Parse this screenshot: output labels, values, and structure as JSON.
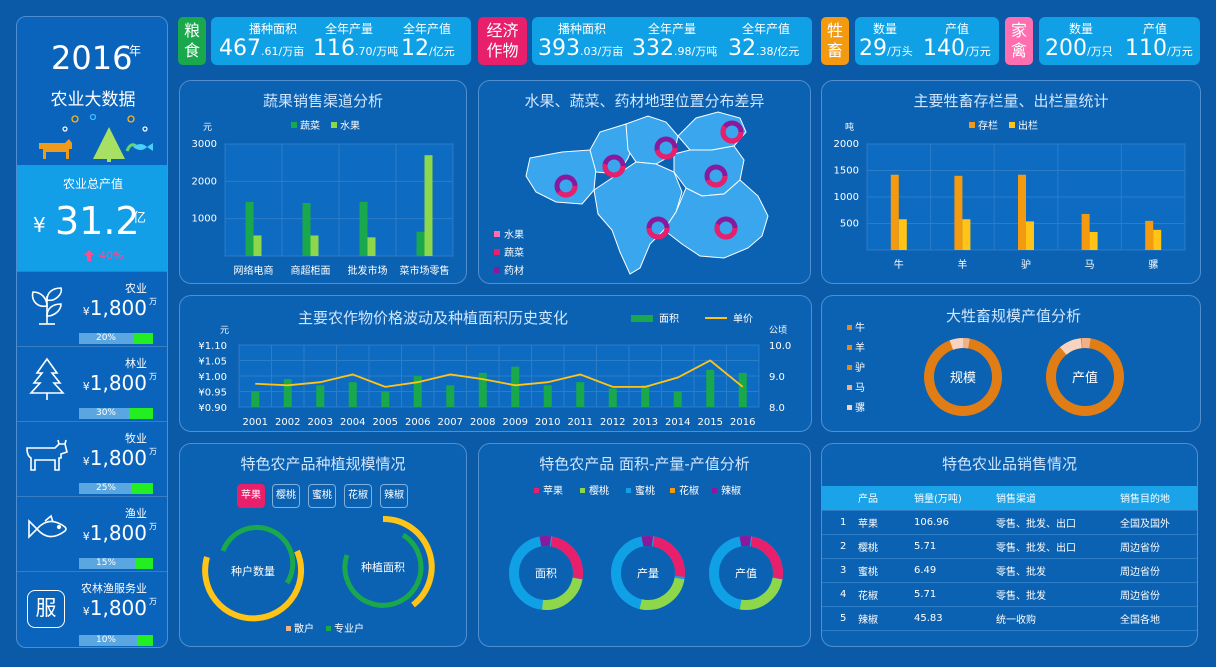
{
  "left": {
    "year": "2016",
    "year_suffix": "年",
    "subtitle": "农业大数据",
    "total_label": "农业总产值",
    "total_prefix": "¥",
    "total_value": "31.2",
    "total_unit": "亿",
    "growth": "40%",
    "sectors": [
      {
        "name": "农业",
        "currency": "¥",
        "value": "1,800",
        "unit": "万",
        "percent": "20%",
        "fill": 0.2,
        "icon": "sprout-icon"
      },
      {
        "name": "林业",
        "currency": "¥",
        "value": "1,800",
        "unit": "万",
        "percent": "30%",
        "fill": 0.3,
        "icon": "tree-icon"
      },
      {
        "name": "牧业",
        "currency": "¥",
        "value": "1,800",
        "unit": "万",
        "percent": "25%",
        "fill": 0.25,
        "icon": "cow-icon"
      },
      {
        "name": "渔业",
        "currency": "¥",
        "value": "1,800",
        "unit": "万",
        "percent": "15%",
        "fill": 0.15,
        "icon": "fish-icon"
      },
      {
        "name": "农林渔服务业",
        "currency": "¥",
        "value": "1,800",
        "unit": "万",
        "percent": "10%",
        "fill": 0.1,
        "icon": "service-icon",
        "icon_text": "服"
      }
    ]
  },
  "header": {
    "grain": {
      "tag": [
        "粮",
        "食"
      ],
      "items": [
        {
          "label": "播种面积",
          "value": "467",
          "decimal": ".61",
          "unit": "/万亩"
        },
        {
          "label": "全年产量",
          "value": "116",
          "decimal": ".70",
          "unit": "/万吨"
        },
        {
          "label": "全年产值",
          "value": "12",
          "decimal": "",
          "unit": "/亿元"
        }
      ]
    },
    "cash": {
      "tag": [
        "经济",
        "作物"
      ],
      "items": [
        {
          "label": "播种面积",
          "value": "393",
          "decimal": ".03",
          "unit": "/万亩"
        },
        {
          "label": "全年产量",
          "value": "332",
          "decimal": ".98",
          "unit": "/万吨"
        },
        {
          "label": "全年产值",
          "value": "32",
          "decimal": ".38",
          "unit": "/亿元"
        }
      ]
    },
    "livestock": {
      "tag": [
        "牲",
        "畜"
      ],
      "items": [
        {
          "label": "数量",
          "value": "29",
          "decimal": "",
          "unit": "/万头"
        },
        {
          "label": "产值",
          "value": "140",
          "decimal": "",
          "unit": "/万元"
        }
      ]
    },
    "poultry": {
      "tag": [
        "家",
        "禽"
      ],
      "items": [
        {
          "label": "数量",
          "value": "200",
          "decimal": "",
          "unit": "/万只"
        },
        {
          "label": "产值",
          "value": "110",
          "decimal": "",
          "unit": "/万元"
        }
      ]
    }
  },
  "colors": {
    "green": "#1aa84c",
    "lightgreen": "#8ed64a",
    "orange": "#f39a10",
    "yellow": "#ffc416",
    "blue": "#0fa0e6",
    "pink": "#e8206b",
    "purple": "#8a1a9c"
  },
  "panels": {
    "veg_channel": "蔬果销售渠道分析",
    "geo": "水果、蔬菜、药材地理位置分布差异",
    "livestock": "主要牲畜存栏量、出栏量统计",
    "price": "主要农作物价格波动及种植面积历史变化",
    "large": "大牲畜规模产值分析",
    "special_scale": "特色农产品种植规模情况",
    "special_analysis": "特色农产品 面积-产量-产值分析",
    "special_sales": "特色农业品销售情况"
  },
  "geo_legend": [
    "水果",
    "蔬菜",
    "药材"
  ],
  "large_donuts": [
    "规模",
    "产值"
  ],
  "large_legend": [
    "牛",
    "羊",
    "驴",
    "马",
    "骡"
  ],
  "scale_tabs": [
    "苹果",
    "樱桃",
    "蜜桃",
    "花椒",
    "辣椒"
  ],
  "scale_donuts": [
    "种户数量",
    "种植面积"
  ],
  "scale_legend": [
    "散户",
    "专业户"
  ],
  "analysis_donuts": [
    "面积",
    "产量",
    "产值"
  ],
  "analysis_legend": [
    "苹果",
    "樱桃",
    "蜜桃",
    "花椒",
    "辣椒"
  ],
  "sales_table": {
    "headers": [
      "产品",
      "销量(万吨)",
      "销售渠道",
      "销售目的地"
    ],
    "rows": [
      [
        "1",
        "苹果",
        "106.96",
        "零售、批发、出口",
        "全国及国外"
      ],
      [
        "2",
        "樱桃",
        "5.71",
        "零售、批发、出口",
        "周边省份"
      ],
      [
        "3",
        "蜜桃",
        "6.49",
        "零售、批发",
        "周边省份"
      ],
      [
        "4",
        "花椒",
        "5.71",
        "零售、批发",
        "周边省份"
      ],
      [
        "5",
        "辣椒",
        "45.83",
        "统一收购",
        "全国各地"
      ]
    ]
  },
  "chart_data": [
    {
      "type": "bar",
      "title": "蔬果销售渠道分析",
      "ylabel": "元",
      "categories": [
        "网络电商",
        "商超柜面",
        "批发市场",
        "菜市场零售"
      ],
      "series": [
        {
          "name": "蔬菜",
          "values": [
            1450,
            1420,
            1450,
            650
          ]
        },
        {
          "name": "水果",
          "values": [
            550,
            550,
            500,
            2700
          ]
        }
      ],
      "ylim": [
        0,
        3000
      ],
      "yticks": [
        "1000",
        "2000",
        "3000"
      ]
    },
    {
      "type": "bar",
      "title": "主要牲畜存栏量、出栏量统计",
      "ylabel": "吨",
      "categories": [
        "牛",
        "羊",
        "驴",
        "马",
        "骡"
      ],
      "series": [
        {
          "name": "存栏",
          "values": [
            1420,
            1400,
            1420,
            680,
            550
          ]
        },
        {
          "name": "出栏",
          "values": [
            580,
            580,
            540,
            340,
            380
          ]
        }
      ],
      "ylim": [
        0,
        2000
      ],
      "yticks": [
        "500",
        "1000",
        "1500",
        "2000"
      ]
    },
    {
      "type": "bar+line",
      "title": "主要农作物价格波动及种植面积历史变化",
      "x": [
        "2001",
        "2002",
        "2003",
        "2004",
        "2005",
        "2006",
        "2007",
        "2008",
        "2009",
        "2010",
        "2011",
        "2012",
        "2013",
        "2014",
        "2015",
        "2016"
      ],
      "series": [
        {
          "name": "面积",
          "axis": "right",
          "values": [
            8.5,
            8.9,
            8.7,
            8.8,
            8.5,
            9.0,
            8.7,
            9.1,
            9.3,
            8.7,
            8.8,
            8.6,
            8.7,
            8.5,
            9.2,
            9.1
          ]
        },
        {
          "name": "单价",
          "axis": "left",
          "values": [
            0.975,
            0.97,
            0.98,
            1.005,
            0.965,
            0.98,
            1.005,
            0.99,
            0.97,
            0.98,
            1.005,
            0.965,
            0.965,
            0.995,
            1.05,
            0.965
          ]
        }
      ],
      "left_label": "元",
      "right_label": "公顷",
      "left_ticks": [
        "¥1.10",
        "¥1.05",
        "¥1.00",
        "¥0.95",
        "¥0.90"
      ],
      "right_ticks": [
        "10.0",
        "9.0",
        "8.0"
      ],
      "left_ylim": [
        0.9,
        1.1
      ],
      "right_ylim": [
        8.0,
        10.0
      ]
    }
  ]
}
